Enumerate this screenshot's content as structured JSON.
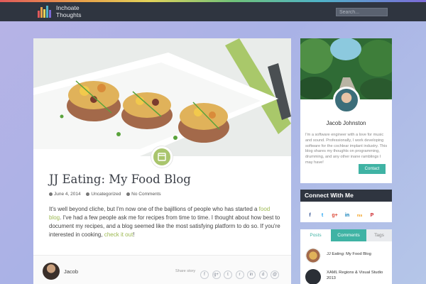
{
  "header": {
    "logo_line1": "Inchoate",
    "logo_line2": "Thoughts",
    "search_placeholder": "Search..."
  },
  "post": {
    "title": "JJ Eating: My Food Blog",
    "date": "June 4, 2014",
    "category": "Uncategorized",
    "comments": "No Comments",
    "excerpt_part1": "It's well beyond cliche, but I'm now one of the bajillions of people who has started a ",
    "link1": "food blog",
    "excerpt_part2": ". I've had a few people ask me for recipes from time to time. I thought about how best to document my recipes, and a blog seemed like the most satisfying platform to do so. If you're interested in cooking, ",
    "link2": "check it out",
    "excerpt_part3": "!",
    "author": "Jacob",
    "share_label": "Share story",
    "share_icons": [
      "f",
      "g+",
      "t",
      "r",
      "in",
      "d",
      "@"
    ]
  },
  "profile": {
    "name": "Jacob Johnston",
    "bio": "I'm a software engineer with a love for music and sound. Professionally, I work developing software for the cochlear implant industry. This blog shares my thoughts on programming, drumming, and any other inane ramblings I may have!",
    "contact_label": "Contact"
  },
  "connect": {
    "title": "Connect With Me",
    "icons": [
      {
        "glyph": "f",
        "color": "#3b5998"
      },
      {
        "glyph": "t",
        "color": "#1da1f2"
      },
      {
        "glyph": "g+",
        "color": "#dd4b39"
      },
      {
        "glyph": "in",
        "color": "#0077b5"
      },
      {
        "glyph": "rss",
        "color": "#f39c12"
      },
      {
        "glyph": "P",
        "color": "#cb2027"
      }
    ]
  },
  "tabs": {
    "posts": "Posts",
    "comments": "Comments",
    "tags": "Tags"
  },
  "recent_posts": [
    {
      "title": "JJ Eating: My Food Blog"
    },
    {
      "title": "XAML Regions & Visual Studio 2013"
    }
  ],
  "colors": {
    "accent": "#3fb3a4",
    "link": "#9bb84f",
    "topbar": "#2f3540"
  }
}
